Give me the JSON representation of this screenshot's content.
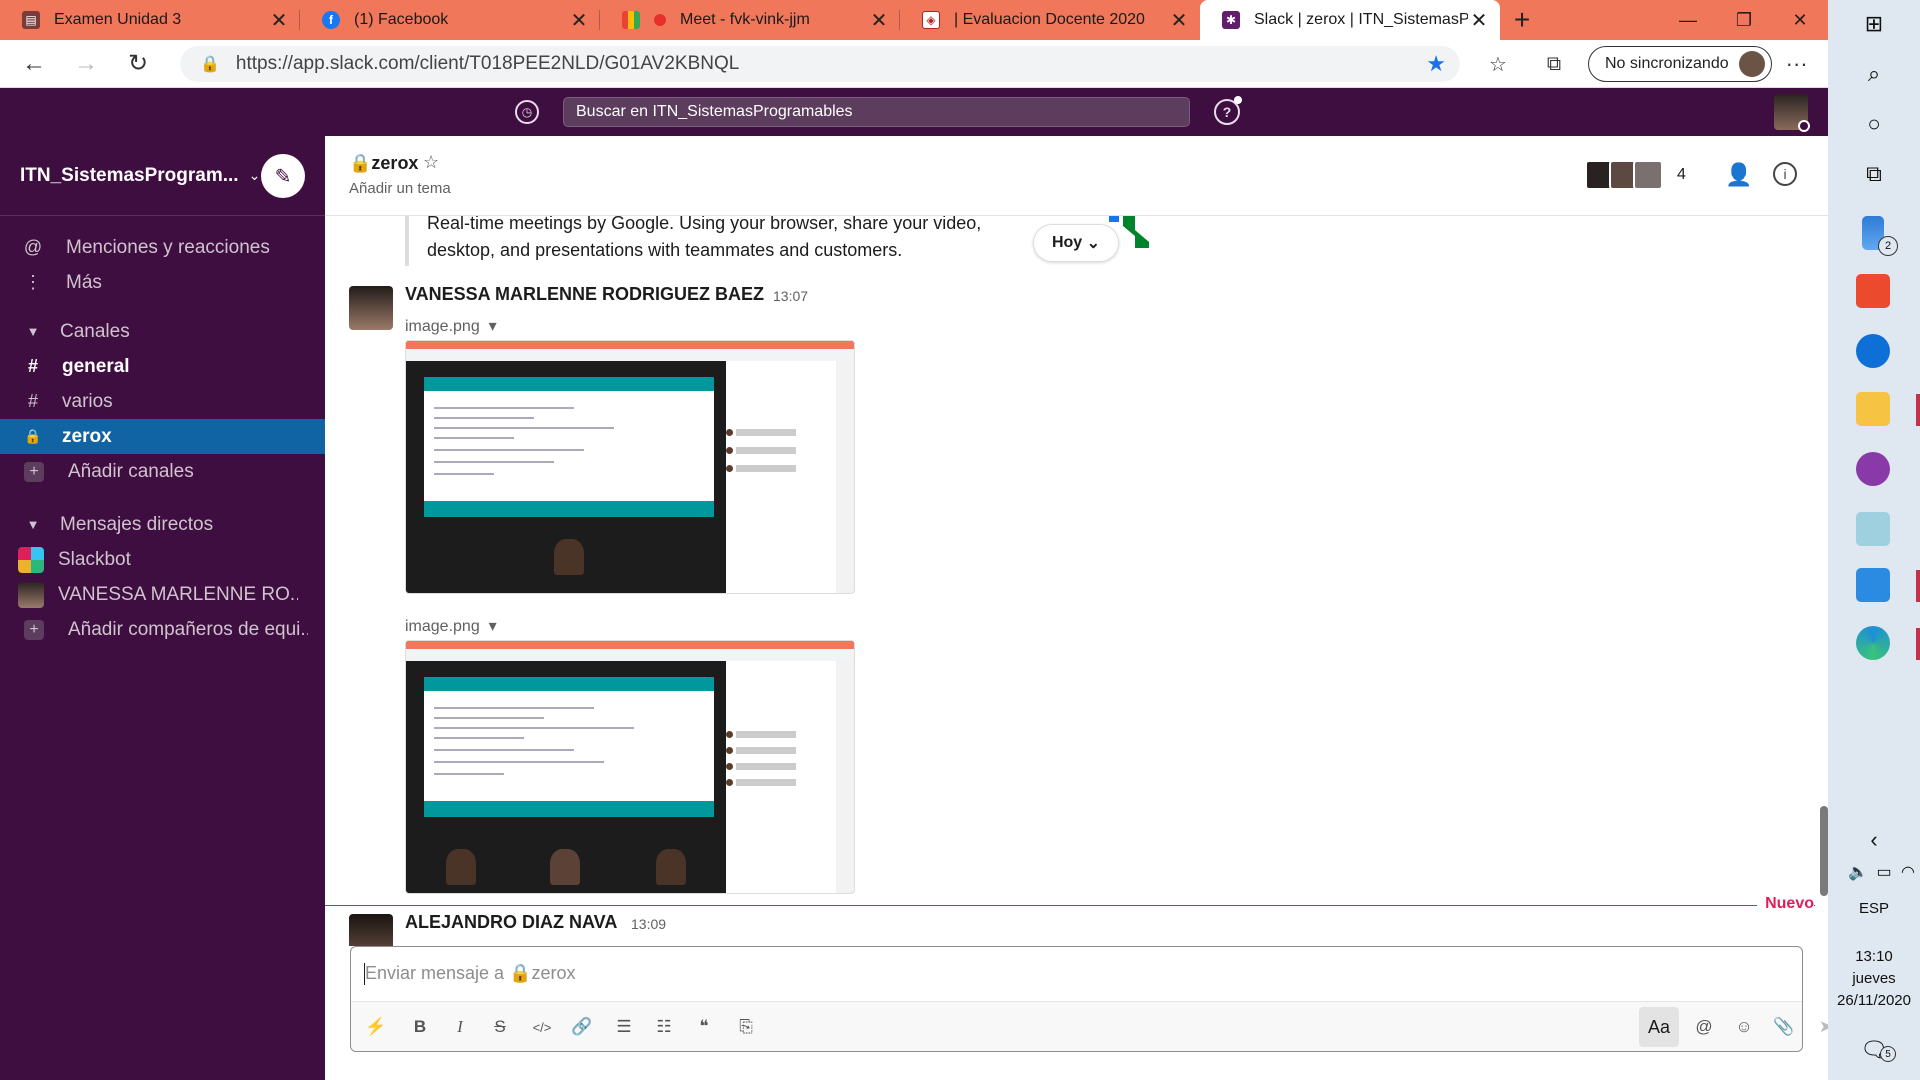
{
  "browser": {
    "tabs": [
      {
        "title": "Examen Unidad 3",
        "favicon_color": "#7a3b3b"
      },
      {
        "title": "(1) Facebook",
        "favicon_color": "#1877f2"
      },
      {
        "title": "Meet - fvk-vink-jjm",
        "favicon_color": "#00832d"
      },
      {
        "title": "| Evaluacion Docente 2020",
        "favicon_color": "#b22222"
      },
      {
        "title": "Slack | zerox | ITN_SistemasProgr",
        "favicon_color": "#611f69"
      }
    ],
    "url": "https://app.slack.com/client/T018PEE2NLD/G01AV2KBNQL",
    "sync_label": "No sincronizando"
  },
  "slack": {
    "search_placeholder": "Buscar en ITN_SistemasProgramables",
    "workspace": "ITN_SistemasProgram...",
    "sidebar": {
      "mentions": "Menciones y reacciones",
      "more": "Más",
      "channels_header": "Canales",
      "channels": [
        {
          "name": "general",
          "icon": "#",
          "bold": true
        },
        {
          "name": "varios",
          "icon": "#",
          "bold": false
        },
        {
          "name": "zerox",
          "icon": "lock",
          "active": true
        }
      ],
      "add_channels": "Añadir canales",
      "dm_header": "Mensajes directos",
      "dms": [
        {
          "name": "Slackbot"
        },
        {
          "name": "VANESSA MARLENNE RO..."
        }
      ],
      "add_teammates": "Añadir compañeros de equi..."
    },
    "channel": {
      "name": "zerox",
      "topic": "Añadir un tema",
      "member_count": "4"
    },
    "messages": {
      "unfurl_text_1": "Real-time meetings by Google. Using your browser, share your video,",
      "unfurl_text_2": "desktop, and presentations with teammates and customers.",
      "date_pill": "Hoy",
      "msg1": {
        "author": "VANESSA MARLENNE RODRIGUEZ BAEZ",
        "time": "13:07",
        "file1": "image.png",
        "file2": "image.png"
      },
      "new_label": "Nuevo",
      "msg2": {
        "author": "ALEJANDRO DIAZ NAVA",
        "time": "13:09"
      }
    },
    "composer": {
      "placeholder": "Enviar mensaje a 🔒zerox",
      "format_label": "Aa"
    }
  },
  "taskbar": {
    "notif_badge_1": "2",
    "lang": "ESP",
    "time": "13:10",
    "day": "jueves",
    "date": "26/11/2020",
    "notif_badge_2": "5"
  }
}
